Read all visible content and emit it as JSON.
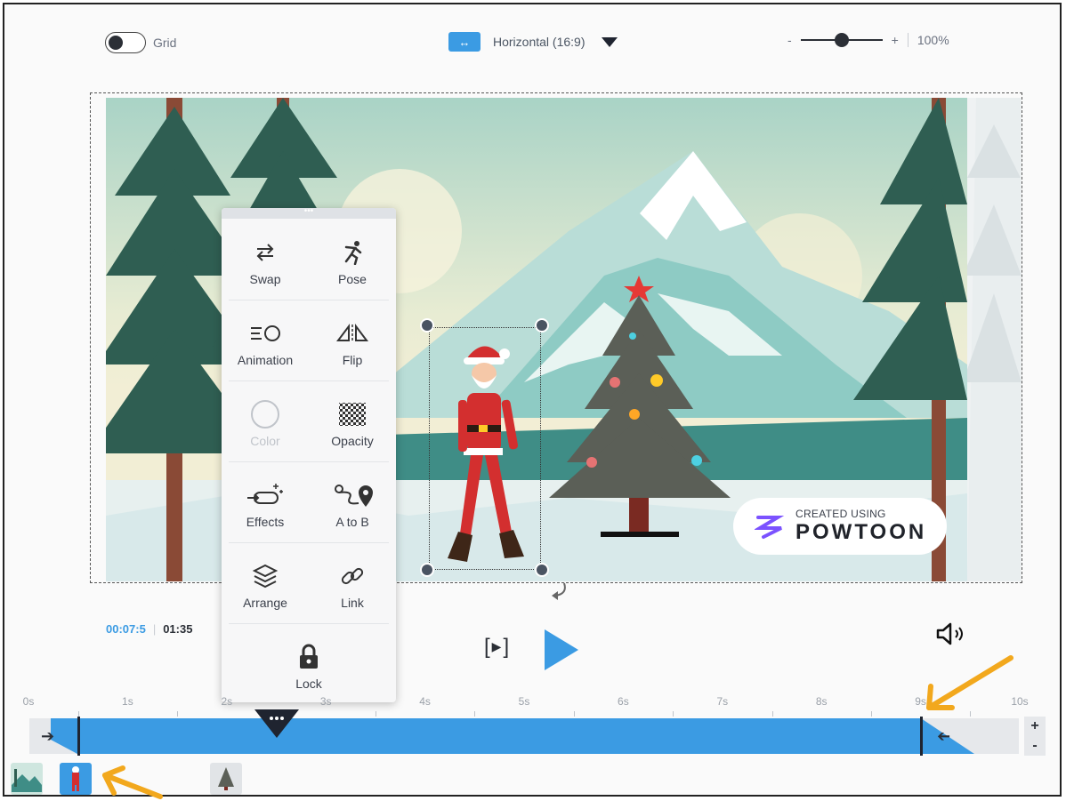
{
  "toolbar": {
    "grid_label": "Grid",
    "grid_enabled": false,
    "aspect_label": "Horizontal (16:9)",
    "zoom_minus": "-",
    "zoom_plus": "+",
    "zoom_value": "100%",
    "zoom_fraction": 0.5
  },
  "context_menu": {
    "items": [
      {
        "label": "Swap",
        "icon": "swap-icon",
        "enabled": true
      },
      {
        "label": "Pose",
        "icon": "pose-icon",
        "enabled": true
      },
      {
        "label": "Animation",
        "icon": "animation-icon",
        "enabled": true
      },
      {
        "label": "Flip",
        "icon": "flip-icon",
        "enabled": true
      },
      {
        "label": "Color",
        "icon": "color-icon",
        "enabled": false
      },
      {
        "label": "Opacity",
        "icon": "opacity-icon",
        "enabled": true
      },
      {
        "label": "Effects",
        "icon": "effects-icon",
        "enabled": true
      },
      {
        "label": "A to B",
        "icon": "a-to-b-icon",
        "enabled": true
      },
      {
        "label": "Arrange",
        "icon": "arrange-icon",
        "enabled": true
      },
      {
        "label": "Link",
        "icon": "link-icon",
        "enabled": true
      },
      {
        "label": "Lock",
        "icon": "lock-icon",
        "enabled": true
      }
    ]
  },
  "watermark": {
    "line1": "CREATED USING",
    "line2": "POWTOON"
  },
  "playback": {
    "current_time": "00:07:5",
    "separator": "|",
    "total_time": "01:35"
  },
  "timeline": {
    "ticks": [
      "0s",
      "1s",
      "2s",
      "3s",
      "4s",
      "5s",
      "6s",
      "7s",
      "8s",
      "9s",
      "10s"
    ],
    "in_seconds": 0.5,
    "out_seconds": 9.0,
    "scrubber_seconds": 2.5
  },
  "colors": {
    "accent": "#3b9be3",
    "annotation": "#f2a81d",
    "dark": "#2b2f36"
  },
  "thumbnails": [
    {
      "name": "background-scene-thumb",
      "selected": false
    },
    {
      "name": "santa-character-thumb",
      "selected": true
    },
    {
      "name": "christmas-tree-thumb",
      "selected": false
    }
  ]
}
